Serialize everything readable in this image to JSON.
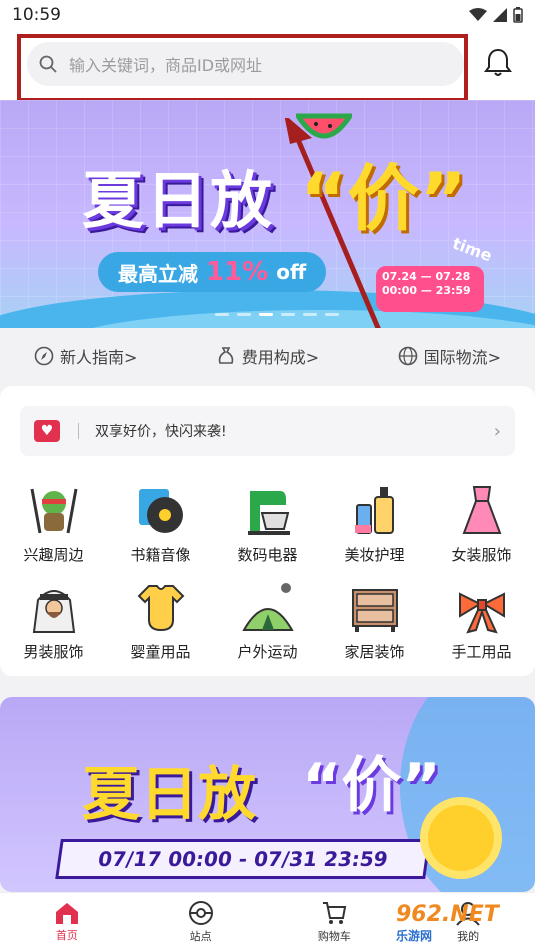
{
  "status": {
    "time": "10:59"
  },
  "search": {
    "placeholder": "输入关键词，商品ID或网址"
  },
  "banner": {
    "title": "夏日放",
    "price_word": "“价”",
    "sub_label": "最高立减",
    "sub_pct": "11%",
    "sub_suffix": "off",
    "date_start": "07.24",
    "date_end": "07.28",
    "time_start": "00:00",
    "time_end": "23:59",
    "time_word": "time"
  },
  "guide": [
    {
      "label": "新人指南>"
    },
    {
      "label": "费用构成>"
    },
    {
      "label": "国际物流>"
    }
  ],
  "notice": {
    "text": "双享好价，快闪来袭!"
  },
  "categories": [
    {
      "label": "兴趣周边",
      "icon": "ninja-turtle-icon"
    },
    {
      "label": "书籍音像",
      "icon": "vinyl-record-icon"
    },
    {
      "label": "数码电器",
      "icon": "stand-mixer-icon"
    },
    {
      "label": "美妆护理",
      "icon": "cosmetics-bottles-icon"
    },
    {
      "label": "女装服饰",
      "icon": "pink-dress-icon"
    },
    {
      "label": "男装服饰",
      "icon": "arab-man-icon"
    },
    {
      "label": "婴童用品",
      "icon": "baby-onesie-icon"
    },
    {
      "label": "户外运动",
      "icon": "tent-icon"
    },
    {
      "label": "家居装饰",
      "icon": "dresser-icon"
    },
    {
      "label": "手工用品",
      "icon": "scarf-bow-icon"
    }
  ],
  "promo": {
    "title": "夏日放",
    "price_word": "“价”",
    "date_range": "07/17 00:00 - 07/31 23:59"
  },
  "tabs": [
    {
      "label": "首页",
      "icon": "home-icon"
    },
    {
      "label": "站点",
      "icon": "site-icon"
    },
    {
      "label": "购物车",
      "icon": "cart-icon"
    },
    {
      "label": "我的",
      "icon": "profile-icon"
    }
  ],
  "watermark": {
    "main": "962.NET",
    "sub": "乐游网"
  },
  "colors": {
    "accent": "#e1314f",
    "highlight_box": "#b01e1e",
    "banner_purple": "#b9a8f5"
  }
}
